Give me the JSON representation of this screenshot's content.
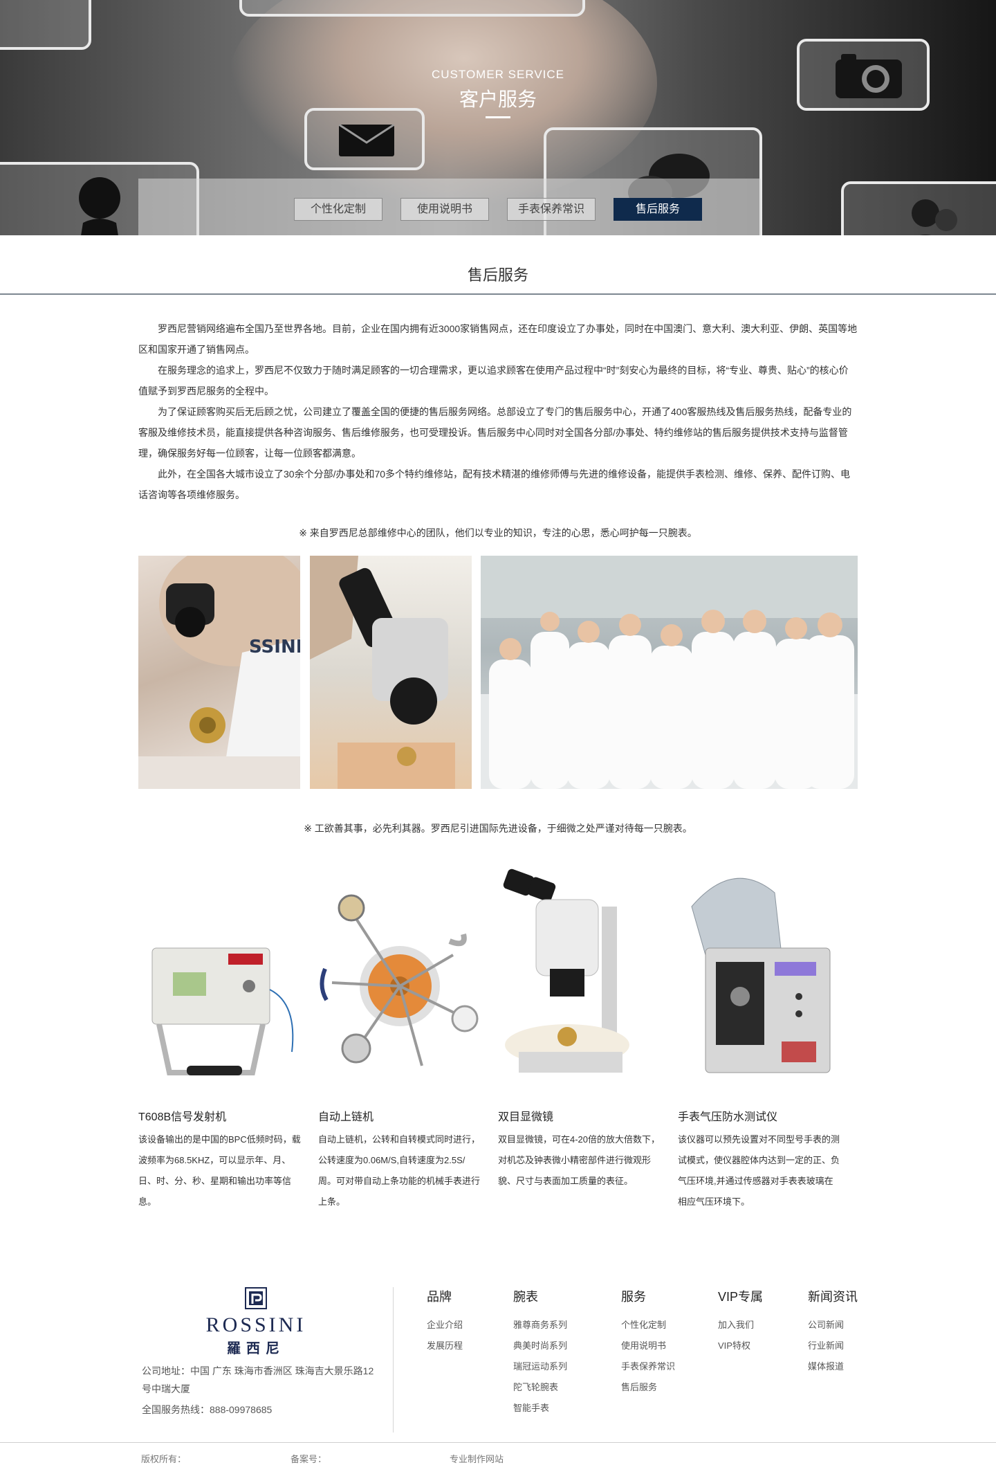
{
  "hero": {
    "en_title": "CUSTOMER SERVICE",
    "cn_title": "客户服务",
    "tabs": [
      {
        "label": "个性化定制",
        "active": false
      },
      {
        "label": "使用说明书",
        "active": false
      },
      {
        "label": "手表保养常识",
        "active": false
      },
      {
        "label": "售后服务",
        "active": true
      }
    ]
  },
  "section": {
    "title": "售后服务",
    "paragraphs": [
      "罗西尼营销网络遍布全国乃至世界各地。目前，企业在国内拥有近3000家销售网点，还在印度设立了办事处，同时在中国澳门、意大利、澳大利亚、伊朗、英国等地区和国家开通了销售网点。",
      "在服务理念的追求上，罗西尼不仅致力于随时满足顾客的一切合理需求，更以追求顾客在使用产品过程中“时”刻安心为最终的目标，将“专业、尊贵、贴心”的核心价值赋予到罗西尼服务的全程中。",
      "为了保证顾客购买后无后顾之忧，公司建立了覆盖全国的便捷的售后服务网络。总部设立了专门的售后服务中心，开通了400客服热线及售后服务热线，配备专业的客服及维修技术员，能直接提供各种咨询服务、售后维修服务，也可受理投诉。售后服务中心同时对全国各分部/办事处、特约维修站的售后服务提供技术支持与监督管理，确保服务好每一位顾客，让每一位顾客都满意。",
      "此外，在全国各大城市设立了30余个分部/办事处和70多个特约维修站，配有技术精湛的维修师傅与先进的维修设备，能提供手表检测、维修、保养、配件订购、电话咨询等各项维修服务。"
    ],
    "note1": "※ 来自罗西尼总部维修中心的团队，他们以专业的知识，专注的心思，悉心呵护每一只腕表。",
    "note2": "※ 工欲善其事，必先利其器。罗西尼引进国际先进设备，于细微之处严谨对待每一只腕表。"
  },
  "equipment": [
    {
      "name": "T608B信号发射机",
      "desc": "该设备输出的是中国的BPC低频时码，载波频率为68.5KHZ，可以显示年、月、日、时、分、秒、星期和输出功率等信息。"
    },
    {
      "name": "自动上链机",
      "desc": "自动上链机，公转和自转模式同时进行，公转速度为0.06M/S,自转速度为2.5S/周。可对带自动上条功能的机械手表进行上条。"
    },
    {
      "name": "双目显微镜",
      "desc": "双目显微镜，可在4-20倍的放大倍数下，对机芯及钟表微小精密部件进行微观形貌、尺寸与表面加工质量的表征。"
    },
    {
      "name": "手表气压防水测试仪",
      "desc": "该仪器可以预先设置对不同型号手表的测试模式，使仪器腔体内达到一定的正、负气压环境,并通过传感器对手表表玻璃在相应气压环境下。"
    }
  ],
  "footer": {
    "brand_en": "ROSSINI",
    "brand_cn": "羅西尼",
    "address": "公司地址：中国 广东 珠海市香洲区 珠海吉大景乐路12号中瑞大厦",
    "hotline": "全国服务热线：888-09978685",
    "columns": [
      {
        "title": "品牌",
        "links": [
          "企业介绍",
          "发展历程"
        ]
      },
      {
        "title": "腕表",
        "links": [
          "雅尊商务系列",
          "典美时尚系列",
          "瑞冠运动系列",
          "陀飞轮腕表",
          "智能手表"
        ]
      },
      {
        "title": "服务",
        "links": [
          "个性化定制",
          "使用说明书",
          "手表保养常识",
          "售后服务"
        ]
      },
      {
        "title": "VIP专属",
        "links": [
          "加入我们",
          "VIP特权"
        ]
      },
      {
        "title": "新闻资讯",
        "links": [
          "公司新闻",
          "行业新闻",
          "媒体报道"
        ]
      }
    ],
    "copyright": "版权所有：",
    "icp": "备案号：",
    "maker": "专业制作网站"
  }
}
